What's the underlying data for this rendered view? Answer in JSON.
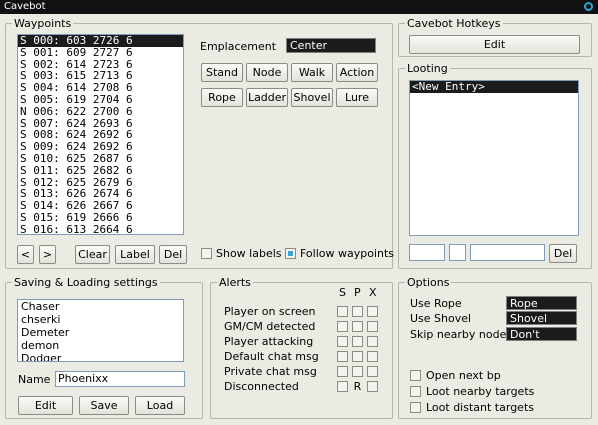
{
  "title": "Cavebot",
  "waypoints": {
    "legend": "Waypoints",
    "rows": [
      "S 000: 603 2726 6",
      "S 001: 609 2727 6",
      "S 002: 614 2723 6",
      "S 003: 615 2713 6",
      "S 004: 614 2708 6",
      "S 005: 619 2704 6",
      "N 006: 622 2700 6",
      "S 007: 624 2693 6",
      "S 008: 624 2692 6",
      "S 009: 624 2692 6",
      "S 010: 625 2687 6",
      "S 011: 625 2682 6",
      "S 012: 625 2679 6",
      "S 013: 626 2674 6",
      "S 014: 626 2667 6",
      "S 015: 619 2666 6",
      "S 016: 613 2664 6"
    ],
    "emplacement_label": "Emplacement",
    "emplacement_value": "Center",
    "buttons": [
      "Stand",
      "Node",
      "Walk",
      "Action",
      "Rope",
      "Ladder",
      "Shovel",
      "Lure"
    ],
    "prev": "<",
    "next": ">",
    "clear": "Clear",
    "label": "Label",
    "del": "Del",
    "show_labels": "Show labels",
    "follow_waypoints": "Follow waypoints"
  },
  "hotkeys": {
    "legend": "Cavebot Hotkeys",
    "edit": "Edit"
  },
  "looting": {
    "legend": "Looting",
    "entries": [
      "<New Entry>"
    ],
    "del": "Del"
  },
  "saving": {
    "legend": "Saving & Loading settings",
    "names": [
      "Chaser",
      "chserki",
      "Demeter",
      "demon",
      "Dodger"
    ],
    "name_label": "Name",
    "name_value": "Phoenixx",
    "edit": "Edit",
    "save": "Save",
    "load": "Load"
  },
  "alerts": {
    "legend": "Alerts",
    "headers": [
      "S",
      "P",
      "X"
    ],
    "items": [
      "Player on screen",
      "GM/CM detected",
      "Player attacking",
      "Default chat msg",
      "Private chat msg",
      "Disconnected"
    ],
    "disconnected_p": "R"
  },
  "options": {
    "legend": "Options",
    "rows": [
      {
        "label": "Use Rope",
        "value": "Rope"
      },
      {
        "label": "Use Shovel",
        "value": "Shovel"
      },
      {
        "label": "Skip nearby nodes",
        "value": "Don't"
      }
    ],
    "checks": [
      "Open next bp",
      "Loot nearby targets",
      "Loot distant targets"
    ]
  }
}
